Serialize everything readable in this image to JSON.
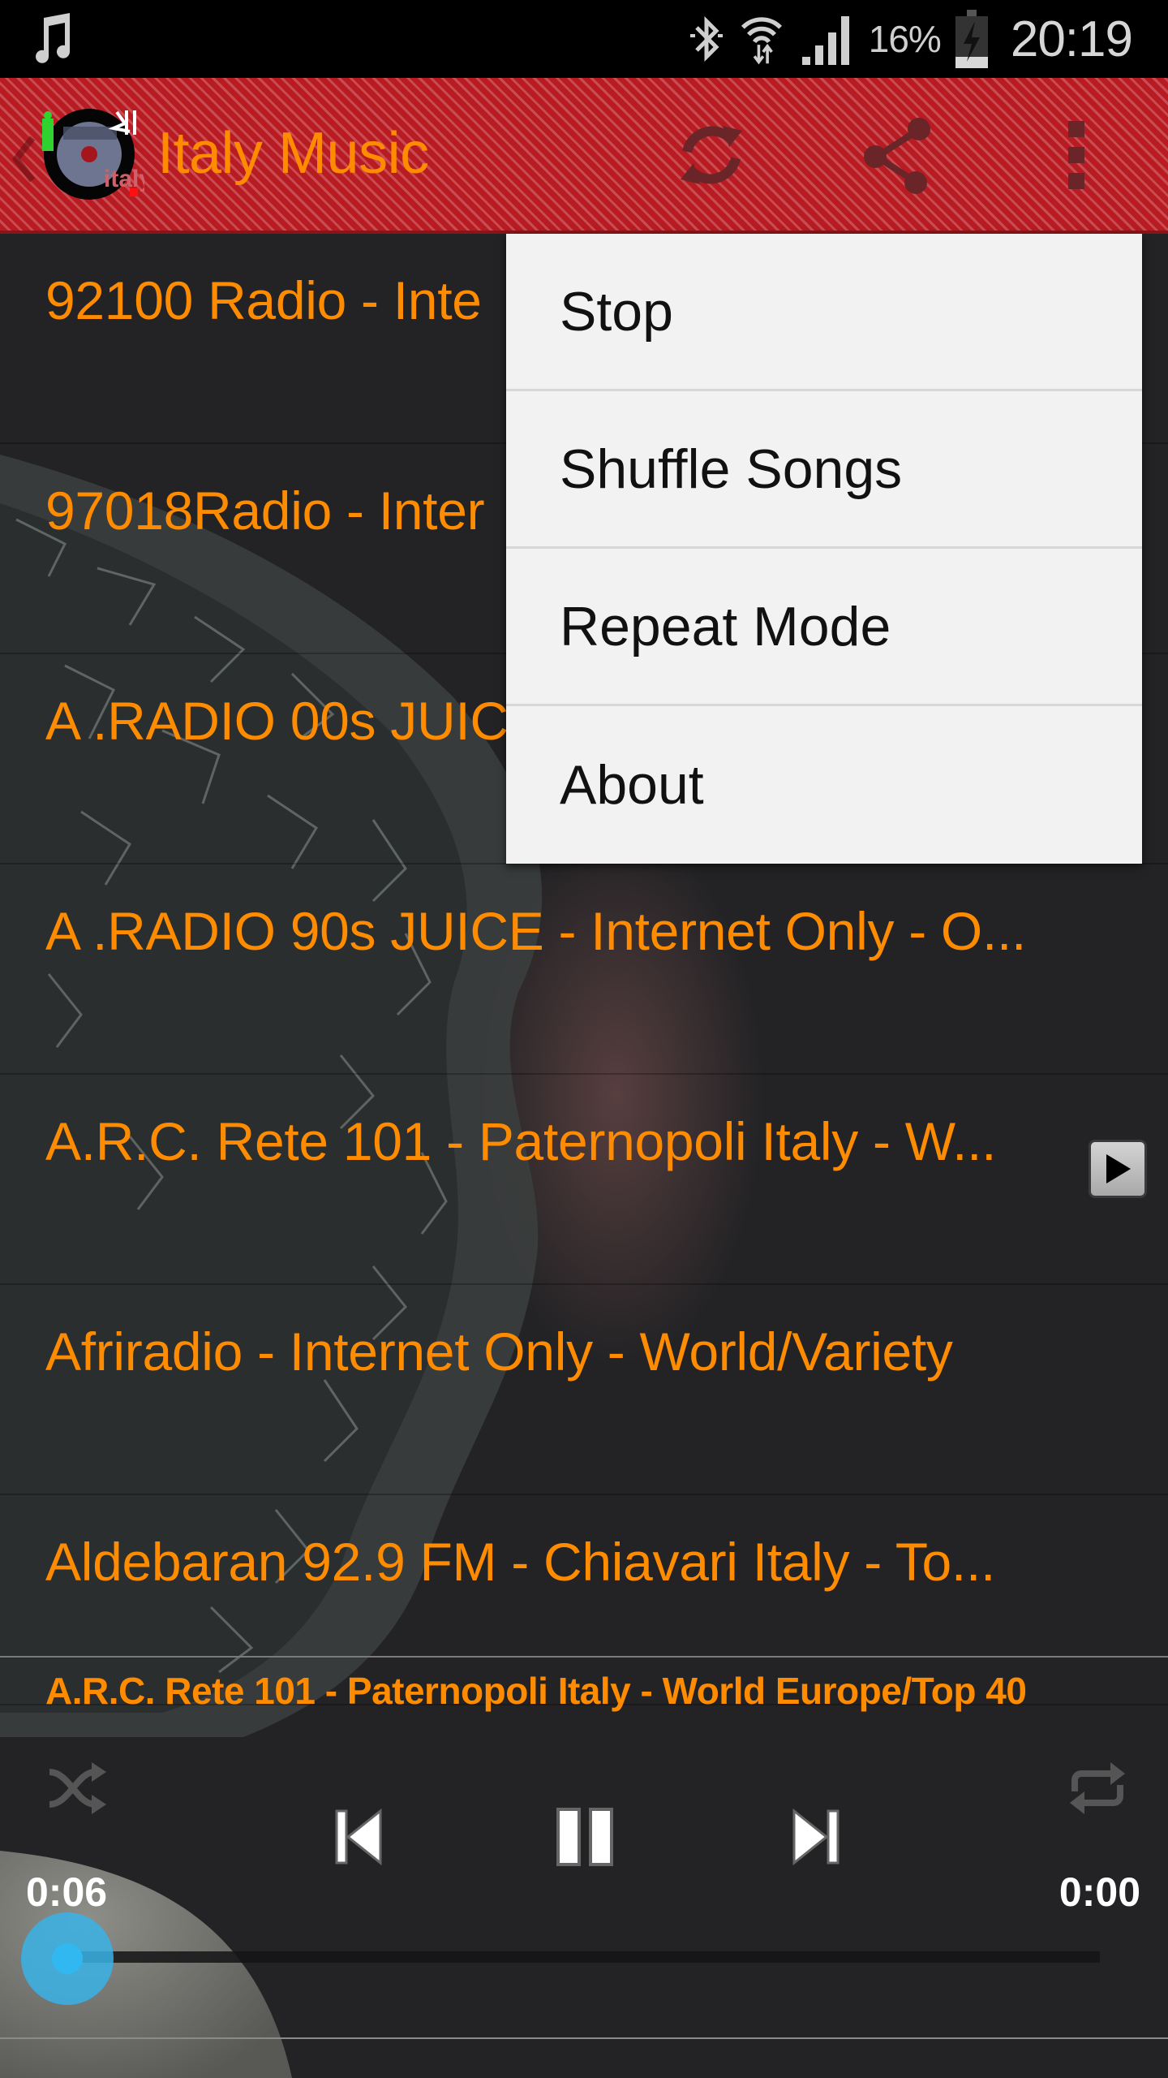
{
  "status_bar": {
    "left_icons": [
      "music-note-icon"
    ],
    "right_icons": [
      "bluetooth-icon",
      "wifi-icon",
      "signal-icon"
    ],
    "battery_percent": "16%",
    "battery_icon": "battery-charging-icon",
    "time": "20:19"
  },
  "action_bar": {
    "title": "Italy Music",
    "actions": [
      "refresh-icon",
      "share-icon",
      "more-vert-icon"
    ],
    "brand_color": "#b81b21",
    "title_color": "#ff8c00"
  },
  "stations": [
    {
      "label": "92100 Radio - Inte",
      "has_play": false
    },
    {
      "label": "97018Radio - Inter",
      "has_play": false
    },
    {
      "label": "A .RADIO 00s JUIC",
      "has_play": false
    },
    {
      "label": "A .RADIO 90s JUICE - Internet Only - O...",
      "has_play": false
    },
    {
      "label": "A.R.C. Rete 101 - Paternopoli Italy - W...",
      "has_play": true
    },
    {
      "label": "Afriradio - Internet Only - World/Variety",
      "has_play": false
    },
    {
      "label": "Aldebaran 92.9 FM - Chiavari Italy - To...",
      "has_play": false
    }
  ],
  "overflow_menu": {
    "items": [
      "Stop",
      "Shuffle Songs",
      "Repeat Mode",
      "About"
    ]
  },
  "player": {
    "now_playing": "A.R.C. Rete 101 - Paternopoli Italy - World Europe/Top 40",
    "elapsed": "0:06",
    "total": "0:00",
    "progress_fraction": 0.0,
    "state": "playing",
    "accent_color": "#31b8f0"
  }
}
